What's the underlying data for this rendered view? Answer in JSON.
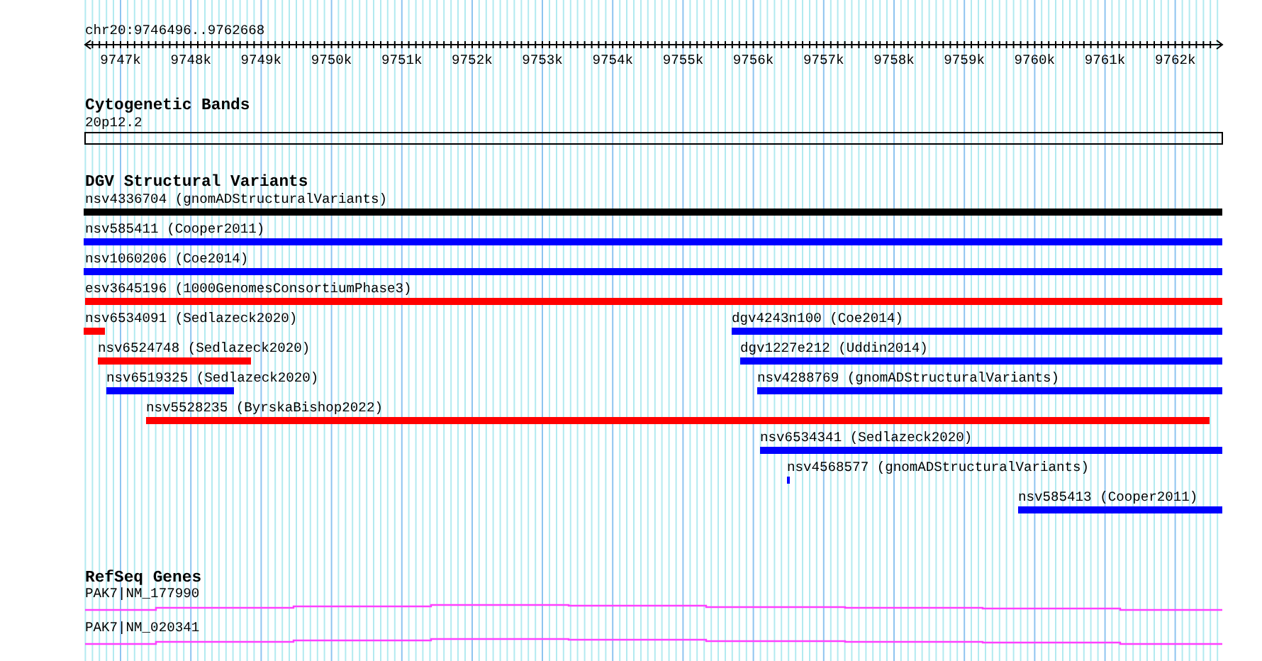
{
  "location": "chr20:9746496..9762668",
  "ruler": {
    "ticks": [
      "9747k",
      "9748k",
      "9749k",
      "9750k",
      "9751k",
      "9752k",
      "9753k",
      "9754k",
      "9755k",
      "9756k",
      "9757k",
      "9758k",
      "9759k",
      "9760k",
      "9761k",
      "9762k"
    ]
  },
  "tracks": [
    {
      "kind": "cytoband",
      "title": "Cytogenetic Bands",
      "features": [
        {
          "label": "20p12.2"
        }
      ]
    },
    {
      "kind": "variants",
      "title": "DGV Structural Variants",
      "features": [
        {
          "label": "nsv4336704 (gnomADStructuralVariants)",
          "color": "#000000"
        },
        {
          "label": "nsv585411 (Cooper2011)",
          "color": "#0000ff"
        },
        {
          "label": "nsv1060206 (Coe2014)",
          "color": "#0000ff"
        },
        {
          "label": "esv3645196 (1000GenomesConsortiumPhase3)",
          "color": "#ff0000"
        },
        {
          "label": "nsv6534091 (Sedlazeck2020)",
          "color": "#ff0000"
        },
        {
          "label": "dgv4243n100 (Coe2014)",
          "color": "#0000ff"
        },
        {
          "label": "nsv6524748 (Sedlazeck2020)",
          "color": "#ff0000"
        },
        {
          "label": "dgv1227e212 (Uddin2014)",
          "color": "#0000ff"
        },
        {
          "label": "nsv6519325 (Sedlazeck2020)",
          "color": "#0000ff"
        },
        {
          "label": "nsv4288769 (gnomADStructuralVariants)",
          "color": "#0000ff"
        },
        {
          "label": "nsv5528235 (ByrskaBishop2022)",
          "color": "#ff0000"
        },
        {
          "label": "nsv6534341 (Sedlazeck2020)",
          "color": "#0000ff"
        },
        {
          "label": "nsv4568577 (gnomADStructuralVariants)",
          "color": "#0000ff"
        },
        {
          "label": "nsv585413 (Cooper2011)",
          "color": "#0000ff"
        }
      ]
    },
    {
      "kind": "genes",
      "title": "RefSeq Genes",
      "features": [
        {
          "label": "PAK7|NM_177990"
        },
        {
          "label": "PAK7|NM_020341"
        }
      ]
    }
  ]
}
